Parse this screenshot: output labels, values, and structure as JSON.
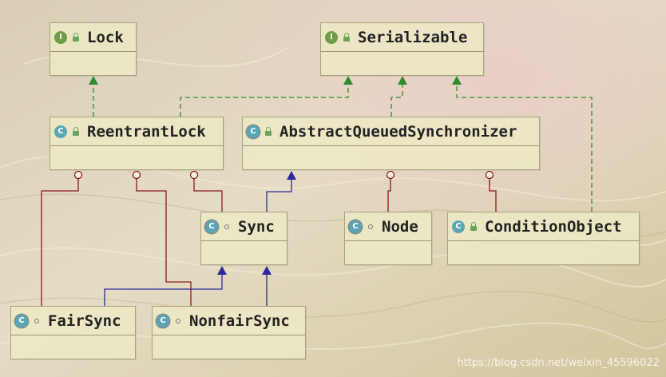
{
  "diagram": {
    "nodes": {
      "lock": {
        "name": "Lock",
        "kind": "interface",
        "badge": "I"
      },
      "serializable": {
        "name": "Serializable",
        "kind": "interface",
        "badge": "I"
      },
      "reentrant_lock": {
        "name": "ReentrantLock",
        "kind": "class",
        "badge": "C"
      },
      "aqs": {
        "name": "AbstractQueuedSynchronizer",
        "kind": "abstract-class",
        "badge": "C"
      },
      "sync": {
        "name": "Sync",
        "kind": "abstract-class",
        "badge": "C"
      },
      "node": {
        "name": "Node",
        "kind": "abstract-class",
        "badge": "C"
      },
      "condition_object": {
        "name": "ConditionObject",
        "kind": "class",
        "badge": "C"
      },
      "fair_sync": {
        "name": "FairSync",
        "kind": "abstract-class",
        "badge": "C"
      },
      "nonfair_sync": {
        "name": "NonfairSync",
        "kind": "abstract-class",
        "badge": "C"
      }
    },
    "relations": [
      {
        "from": "reentrant_lock",
        "to": "lock",
        "type": "implements"
      },
      {
        "from": "reentrant_lock",
        "to": "serializable",
        "type": "implements"
      },
      {
        "from": "aqs",
        "to": "serializable",
        "type": "implements"
      },
      {
        "from": "condition_object",
        "to": "serializable",
        "type": "implements"
      },
      {
        "from": "sync",
        "to": "aqs",
        "type": "extends"
      },
      {
        "from": "fair_sync",
        "to": "sync",
        "type": "extends"
      },
      {
        "from": "nonfair_sync",
        "to": "sync",
        "type": "extends"
      },
      {
        "from": "reentrant_lock",
        "to": "sync",
        "type": "inner-class"
      },
      {
        "from": "reentrant_lock",
        "to": "fair_sync",
        "type": "inner-class"
      },
      {
        "from": "reentrant_lock",
        "to": "nonfair_sync",
        "type": "inner-class"
      },
      {
        "from": "aqs",
        "to": "node",
        "type": "inner-class"
      },
      {
        "from": "aqs",
        "to": "condition_object",
        "type": "inner-class"
      }
    ],
    "colors": {
      "implements": "#2e8b2e",
      "extends": "#2a2a9a",
      "inner_class": "#8b1a1a"
    }
  },
  "watermark": "https://blog.csdn.net/weixin_45596022"
}
